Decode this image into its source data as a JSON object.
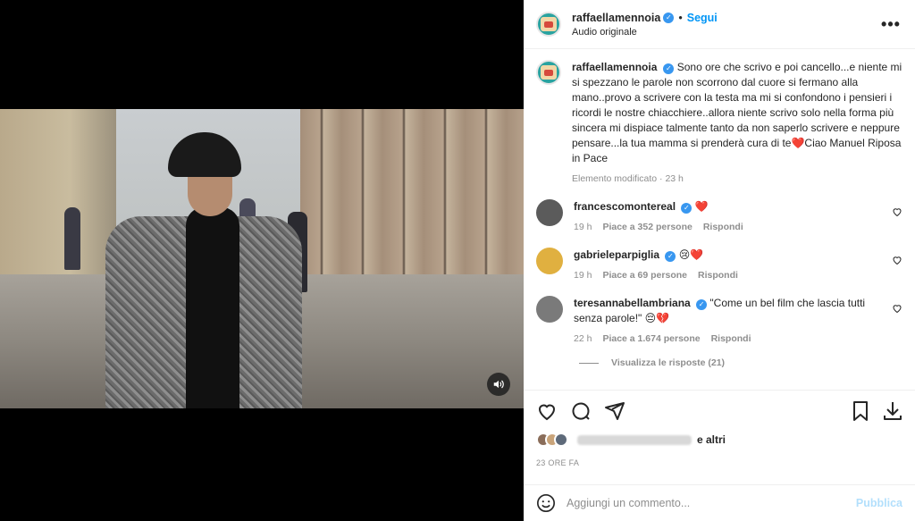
{
  "post": {
    "username": "raffaellamennoia",
    "follow_label": "Segui",
    "audio": "Audio originale",
    "more_label": "•••"
  },
  "caption": {
    "username": "raffaellamennoia",
    "text": "Sono ore che scrivo e poi cancello...e niente mi si spezzano le parole non scorrono dal cuore si fermano alla mano..provo a scrivere con la testa ma mi si confondono i pensieri i ricordi le nostre chiacchiere..allora niente scrivo solo nella forma più sincera mi dispiace talmente tanto da non saperlo scrivere e neppure pensare...la tua mamma si prenderà cura di te❤️Ciao Manuel Riposa in Pace",
    "edited": "Elemento modificato · 23 h"
  },
  "comments": [
    {
      "username": "francescomontereal",
      "text": "❤️",
      "time": "19 h",
      "likes": "Piace a 352 persone",
      "reply": "Rispondi",
      "avatar_color": "#5b5b5b"
    },
    {
      "username": "gabrieleparpiglia",
      "text": "😢❤️",
      "time": "19 h",
      "likes": "Piace a 69 persone",
      "reply": "Rispondi",
      "avatar_color": "#e0b040"
    },
    {
      "username": "teresannabellambriana",
      "text": "\"Come un bel film che lascia tutti senza parole!\" 😔💔",
      "time": "22 h",
      "likes": "Piace a 1.674 persone",
      "reply": "Rispondi",
      "avatar_color": "#7a7a7a"
    }
  ],
  "view_replies": "Visualizza le risposte (21)",
  "likes_summary": {
    "suffix": "e altri"
  },
  "timestamp": "23 ORE FA",
  "comment_box": {
    "placeholder": "Aggiungi un commento...",
    "publish": "Pubblica"
  },
  "colors": {
    "accent": "#0095f6",
    "verified": "#3897f0",
    "heart": "#ed4956"
  }
}
